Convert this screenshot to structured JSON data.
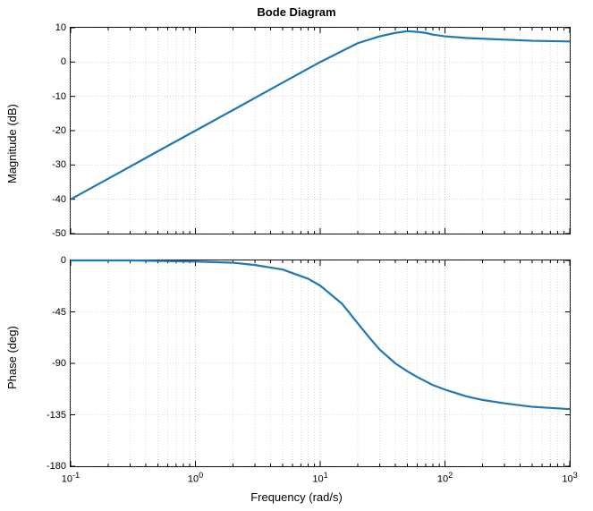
{
  "title": "Bode Diagram",
  "xlabel": "Frequency  (rad/s)",
  "ylabel_top": "Magnitude (dB)",
  "ylabel_bot": "Phase (deg)",
  "mag": {
    "yticks": [
      -50,
      -40,
      -30,
      -20,
      -10,
      0,
      10
    ],
    "ymin": -50,
    "ymax": 10
  },
  "phase": {
    "yticks": [
      -180,
      -135,
      -90,
      -45,
      0
    ],
    "ymin": -180,
    "ymax": 0
  },
  "xticks_exp": [
    -1,
    0,
    1,
    2,
    3
  ],
  "xmin_exp": -1,
  "xmax_exp": 3,
  "chart_data": [
    {
      "type": "line",
      "title": "Bode Diagram — Magnitude",
      "xlabel": "Frequency (rad/s)",
      "ylabel": "Magnitude (dB)",
      "xscale": "log",
      "xlim": [
        0.1,
        1000
      ],
      "ylim": [
        -50,
        10
      ],
      "grid": true,
      "x": [
        0.1,
        0.2,
        0.5,
        1,
        2,
        5,
        10,
        20,
        30,
        40,
        50,
        60,
        70,
        80,
        100,
        150,
        200,
        500,
        1000
      ],
      "y": [
        -40,
        -34,
        -26,
        -20,
        -14,
        -6,
        0,
        5.5,
        7.5,
        8.5,
        9,
        8.8,
        8.5,
        8,
        7.5,
        7,
        6.8,
        6.2,
        6
      ]
    },
    {
      "type": "line",
      "title": "Bode Diagram — Phase",
      "xlabel": "Frequency (rad/s)",
      "ylabel": "Phase (deg)",
      "xscale": "log",
      "xlim": [
        0.1,
        1000
      ],
      "ylim": [
        -180,
        0
      ],
      "grid": true,
      "x": [
        0.1,
        0.3,
        1,
        2,
        3,
        5,
        8,
        10,
        15,
        20,
        25,
        30,
        40,
        50,
        60,
        80,
        100,
        150,
        200,
        300,
        500,
        1000
      ],
      "y": [
        0,
        0,
        -1,
        -2,
        -4,
        -8,
        -16,
        -22,
        -38,
        -55,
        -68,
        -78,
        -90,
        -97,
        -102,
        -109,
        -113,
        -119,
        -122,
        -125,
        -128,
        -130
      ]
    }
  ]
}
